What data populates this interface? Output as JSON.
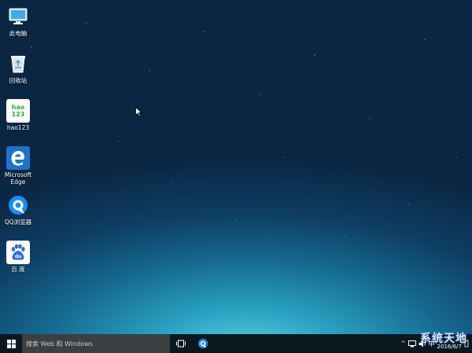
{
  "desktop": {
    "icons": [
      {
        "label": "此电脑",
        "icon": "this-pc-icon"
      },
      {
        "label": "回收站",
        "icon": "recycle-bin-icon"
      },
      {
        "label": "hao123",
        "icon": "hao123-icon",
        "logo_text": "hao\n123"
      },
      {
        "label": "Microsoft\nEdge",
        "icon": "edge-icon"
      },
      {
        "label": "QQ浏览器",
        "icon": "qq-browser-icon"
      },
      {
        "label": "百 度",
        "icon": "baidu-icon",
        "logo_text": "du"
      }
    ]
  },
  "taskbar": {
    "start_icon": "windows-logo-icon",
    "search_placeholder": "搜索 Web 和 Windows",
    "task_view_icon": "task-view-icon",
    "pinned_app_icon": "qq-browser-icon",
    "tray": {
      "ime_label": "中",
      "clock_date": "2016/6/7"
    }
  },
  "watermark": "系统天地",
  "colors": {
    "taskbar_bg": "#0c1820",
    "search_bg": "#3b3f42",
    "edge_blue": "#1e73c8",
    "baidu_blue": "#2d6bd9",
    "hao123_green": "#3aa53a"
  }
}
